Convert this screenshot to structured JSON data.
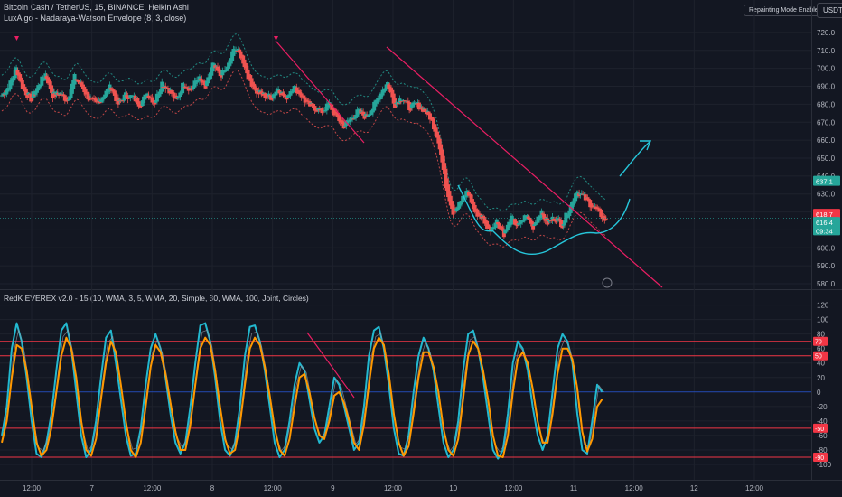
{
  "header": {
    "main_title": "Bitcoin Cash / TetherUS, 15, BINANCE, Heikin Ashi",
    "indicator_title": "LuxAlgo - Nadaraya-Watson Envelope (8, 3, close)",
    "oscillator_title": "RedK EVEREX v2.0 - 15 (10, WMA, 3, 5, WMA, 20, Simple, 30, WMA, 100, Joint, Circles)",
    "repainting_badge": "Repainting Mode Enabled",
    "currency_button": "USDT"
  },
  "colors": {
    "background": "#131722",
    "bull": "#26a69a",
    "bear": "#ef5350",
    "trendline": "#e91e63",
    "annotation": "#26c6da",
    "osc_cyan": "#22b8cf",
    "osc_orange": "#ff9800",
    "level_red": "#f23645",
    "zero_line": "#2962ff"
  },
  "price_axis": {
    "labels": [
      "720.0",
      "710.0",
      "700.0",
      "690.0",
      "680.0",
      "670.0",
      "660.0",
      "650.0",
      "640.0",
      "630.0",
      "620.0",
      "610.0",
      "600.0",
      "590.0",
      "580.0"
    ],
    "tags": [
      {
        "text": "637.1",
        "color": "#26a69a"
      },
      {
        "text": "618.7",
        "color": "#f23645"
      },
      {
        "text": "616.4",
        "color": "#26a69a"
      },
      {
        "text": "09:34",
        "color": "#26a69a"
      }
    ]
  },
  "osc_axis": {
    "labels": [
      "120",
      "100",
      "80",
      "60",
      "40",
      "20",
      "0",
      "-20",
      "-40",
      "-60",
      "-80",
      "-100"
    ],
    "tags": [
      {
        "text": "70",
        "value": 70
      },
      {
        "text": "50",
        "value": 50
      },
      {
        "text": "-50",
        "value": -50
      },
      {
        "text": "-90",
        "value": -90
      }
    ]
  },
  "time_axis": {
    "labels": [
      {
        "text": "12:00",
        "t": 0
      },
      {
        "text": "7",
        "t": 48
      },
      {
        "text": "12:00",
        "t": 96
      },
      {
        "text": "8",
        "t": 144
      },
      {
        "text": "12:00",
        "t": 192
      },
      {
        "text": "9",
        "t": 240
      },
      {
        "text": "12:00",
        "t": 288
      },
      {
        "text": "10",
        "t": 336
      },
      {
        "text": "12:00",
        "t": 384
      },
      {
        "text": "11",
        "t": 432
      },
      {
        "text": "12:00",
        "t": 480
      },
      {
        "text": "12",
        "t": 528
      },
      {
        "text": "12:00",
        "t": 576
      }
    ]
  },
  "chart_data": [
    {
      "type": "candlestick",
      "title": "Bitcoin Cash / TetherUS, 15, BINANCE, Heikin Ashi",
      "ylim": [
        578,
        725
      ],
      "anchor_points": [
        [
          0,
          685
        ],
        [
          6,
          690
        ],
        [
          12,
          700
        ],
        [
          18,
          688
        ],
        [
          24,
          683
        ],
        [
          30,
          690
        ],
        [
          36,
          697
        ],
        [
          42,
          685
        ],
        [
          48,
          686
        ],
        [
          54,
          682
        ],
        [
          60,
          695
        ],
        [
          66,
          690
        ],
        [
          72,
          683
        ],
        [
          78,
          680
        ],
        [
          84,
          685
        ],
        [
          90,
          690
        ],
        [
          96,
          680
        ],
        [
          102,
          685
        ],
        [
          108,
          684
        ],
        [
          114,
          680
        ],
        [
          120,
          686
        ],
        [
          126,
          681
        ],
        [
          132,
          692
        ],
        [
          138,
          688
        ],
        [
          144,
          682
        ],
        [
          150,
          692
        ],
        [
          156,
          688
        ],
        [
          162,
          695
        ],
        [
          168,
          689
        ],
        [
          174,
          702
        ],
        [
          180,
          696
        ],
        [
          186,
          700
        ],
        [
          192,
          712
        ],
        [
          198,
          706
        ],
        [
          204,
          694
        ],
        [
          210,
          687
        ],
        [
          216,
          685
        ],
        [
          222,
          684
        ],
        [
          228,
          689
        ],
        [
          234,
          683
        ],
        [
          240,
          690
        ],
        [
          246,
          686
        ],
        [
          252,
          680
        ],
        [
          258,
          678
        ],
        [
          264,
          676
        ],
        [
          270,
          680
        ],
        [
          276,
          673
        ],
        [
          282,
          668
        ],
        [
          288,
          672
        ],
        [
          294,
          676
        ],
        [
          300,
          673
        ],
        [
          306,
          678
        ],
        [
          312,
          686
        ],
        [
          318,
          692
        ],
        [
          324,
          680
        ],
        [
          330,
          684
        ],
        [
          336,
          678
        ],
        [
          342,
          680
        ],
        [
          348,
          677
        ],
        [
          354,
          672
        ],
        [
          360,
          660
        ],
        [
          366,
          635
        ],
        [
          372,
          620
        ],
        [
          378,
          625
        ],
        [
          384,
          632
        ],
        [
          390,
          620
        ],
        [
          396,
          617
        ],
        [
          402,
          610
        ],
        [
          408,
          615
        ],
        [
          414,
          608
        ],
        [
          420,
          616
        ],
        [
          426,
          612
        ],
        [
          432,
          618
        ],
        [
          438,
          612
        ],
        [
          444,
          620
        ],
        [
          450,
          614
        ],
        [
          456,
          617
        ],
        [
          462,
          613
        ],
        [
          468,
          622
        ],
        [
          474,
          632
        ],
        [
          480,
          628
        ],
        [
          486,
          624
        ],
        [
          492,
          620
        ],
        [
          498,
          615
        ]
      ],
      "last_price": 616.4,
      "price_tags": [
        "637.1",
        "618.7",
        "616.4"
      ],
      "envelope": {
        "name": "LuxAlgo - Nadaraya-Watson Envelope (8, 3, close)",
        "width": 10
      },
      "annotations": [
        "downtrend line 1",
        "downtrend line 2",
        "downtrend line 3",
        "support curve",
        "upside arrow"
      ]
    },
    {
      "type": "line",
      "title": "RedK EVEREX v2.0 - 15 (10, WMA, 3, 5, WMA, 20, Simple, 30, WMA, 100, Joint, Circles)",
      "ylim": [
        -105,
        122
      ],
      "levels": [
        70,
        50,
        0,
        -50,
        -90
      ],
      "series": [
        {
          "name": "cyan",
          "color": "#22b8cf",
          "values": [
            -60,
            -20,
            60,
            95,
            70,
            20,
            -40,
            -85,
            -90,
            -70,
            -30,
            30,
            85,
            95,
            60,
            0,
            -60,
            -90,
            -80,
            -40,
            20,
            75,
            85,
            40,
            -10,
            -60,
            -88,
            -85,
            -50,
            10,
            60,
            80,
            60,
            20,
            -30,
            -70,
            -85,
            -70,
            -20,
            40,
            92,
            95,
            70,
            20,
            -40,
            -80,
            -88,
            -70,
            -20,
            50,
            90,
            92,
            70,
            30,
            -20,
            -70,
            -90,
            -80,
            -40,
            10,
            40,
            30,
            -10,
            -50,
            -70,
            -60,
            -20,
            20,
            10,
            -20,
            -50,
            -80,
            -70,
            -20,
            50,
            85,
            90,
            60,
            10,
            -50,
            -85,
            -88,
            -60,
            0,
            50,
            75,
            60,
            30,
            -20,
            -70,
            -90,
            -80,
            -40,
            30,
            80,
            85,
            60,
            20,
            -30,
            -80,
            -92,
            -80,
            -30,
            40,
            70,
            60,
            30,
            -20,
            -60,
            -80,
            -60,
            0,
            60,
            80,
            70,
            40,
            -30,
            -80,
            -85,
            -40,
            10,
            0
          ]
        },
        {
          "name": "orange",
          "color": "#ff9800",
          "values": [
            -70,
            -40,
            20,
            65,
            60,
            30,
            -20,
            -70,
            -88,
            -80,
            -50,
            0,
            50,
            75,
            60,
            20,
            -40,
            -80,
            -88,
            -65,
            -10,
            40,
            70,
            55,
            10,
            -40,
            -80,
            -90,
            -70,
            -20,
            35,
            65,
            55,
            25,
            -15,
            -55,
            -80,
            -80,
            -45,
            10,
            60,
            75,
            65,
            30,
            -20,
            -65,
            -85,
            -80,
            -45,
            10,
            60,
            75,
            65,
            35,
            -5,
            -50,
            -80,
            -88,
            -65,
            -20,
            20,
            25,
            0,
            -35,
            -60,
            -65,
            -40,
            -5,
            0,
            -15,
            -40,
            -70,
            -80,
            -45,
            10,
            60,
            75,
            65,
            25,
            -30,
            -70,
            -88,
            -75,
            -30,
            20,
            55,
            55,
            35,
            0,
            -50,
            -80,
            -88,
            -65,
            -10,
            50,
            70,
            60,
            30,
            -10,
            -60,
            -88,
            -90,
            -60,
            0,
            45,
            55,
            40,
            5,
            -40,
            -70,
            -70,
            -30,
            25,
            60,
            60,
            45,
            5,
            -55,
            -82,
            -65,
            -20,
            -10
          ]
        }
      ]
    }
  ]
}
